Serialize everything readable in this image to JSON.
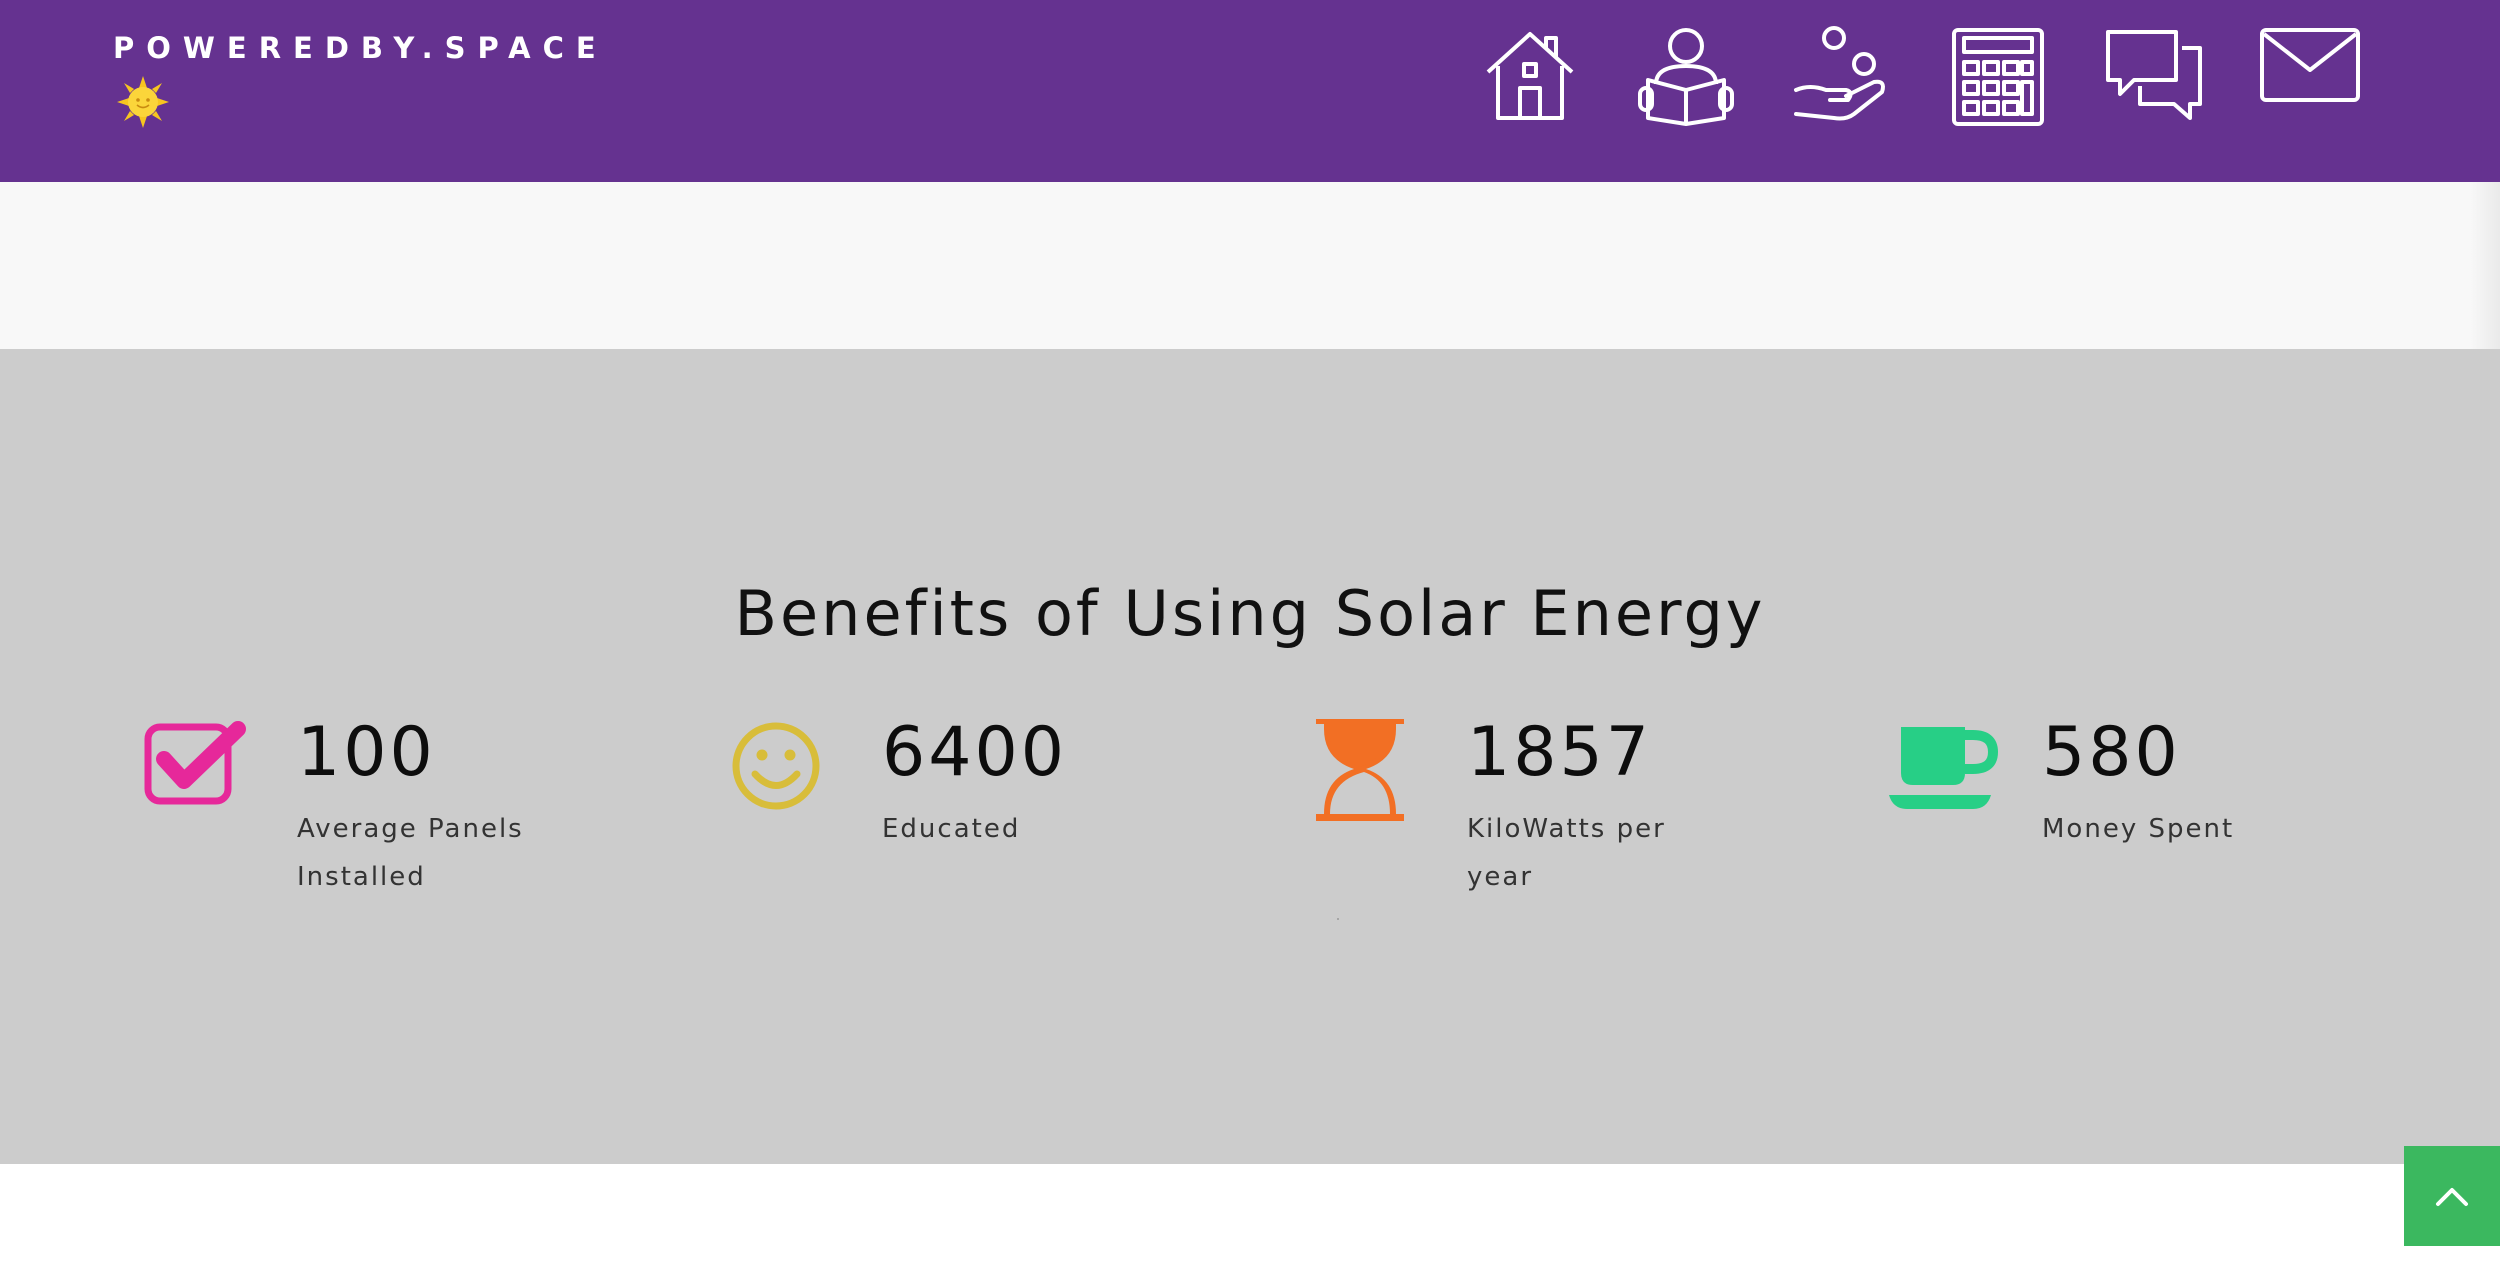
{
  "header": {
    "brand": "POWEREDBY.SPACE",
    "brand_icon": "sun-face-icon",
    "background_color": "#653290",
    "nav": [
      {
        "name": "home",
        "icon": "house-icon"
      },
      {
        "name": "learn",
        "icon": "person-reading-icon"
      },
      {
        "name": "savings",
        "icon": "hand-coins-icon"
      },
      {
        "name": "calculator",
        "icon": "calculator-icon"
      },
      {
        "name": "chat",
        "icon": "chat-bubbles-icon"
      },
      {
        "name": "contact",
        "icon": "envelope-icon"
      }
    ]
  },
  "stats_section": {
    "title": "Benefits of Using Solar Energy",
    "background_color": "#cccccc",
    "items": [
      {
        "value": "100",
        "label": "Average Panels Installed",
        "icon": "checkbox-checked-icon",
        "color": "#e6289a"
      },
      {
        "value": "6400",
        "label": "Educated",
        "icon": "smiley-face-icon",
        "color": "#d8bd3a"
      },
      {
        "value": "1857",
        "label": "KiloWatts per year",
        "icon": "hourglass-icon",
        "color": "#f26f24"
      },
      {
        "value": "580",
        "label": "Money Spent",
        "icon": "coffee-cup-icon",
        "color": "#27cf86"
      }
    ]
  },
  "scroll_top": {
    "icon": "chevron-up-icon",
    "color": "#3bb85f"
  }
}
